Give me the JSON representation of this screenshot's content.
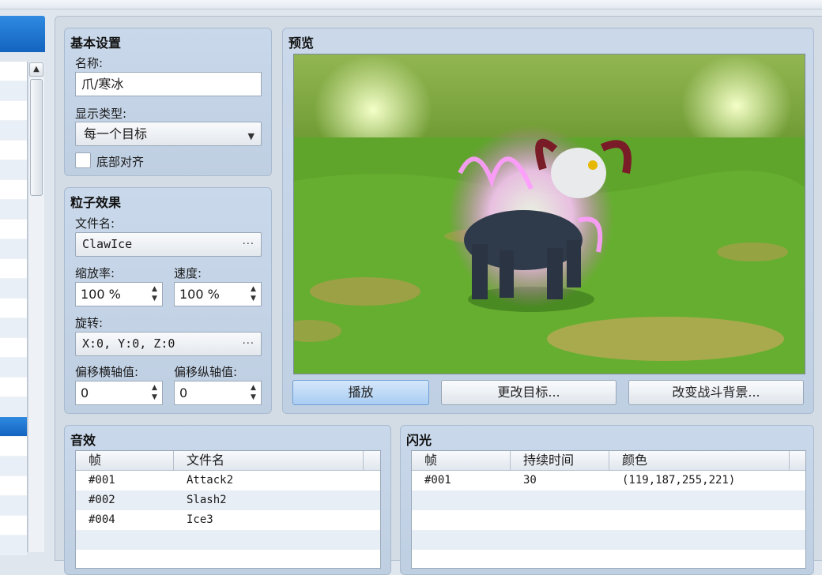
{
  "basic": {
    "title": "基本设置",
    "name_label": "名称:",
    "name_value": "爪/寒冰",
    "display_type_label": "显示类型:",
    "display_type_value": "每一个目标",
    "align_bottom_label": "底部对齐",
    "align_bottom_checked": false
  },
  "particle": {
    "title": "粒子效果",
    "file_label": "文件名:",
    "file_value": "ClawIce",
    "scale_label": "缩放率:",
    "scale_value": "100 %",
    "speed_label": "速度:",
    "speed_value": "100 %",
    "rotation_label": "旋转:",
    "rotation_value": "X:0, Y:0, Z:0",
    "offset_x_label": "偏移横轴值:",
    "offset_x_value": "0",
    "offset_y_label": "偏移纵轴值:",
    "offset_y_value": "0"
  },
  "preview": {
    "title": "预览",
    "play_label": "播放",
    "change_target_label": "更改目标...",
    "change_bg_label": "改变战斗背景..."
  },
  "sound": {
    "title": "音效",
    "columns": [
      "帧",
      "文件名"
    ],
    "rows": [
      {
        "frame": "#001",
        "file": "Attack2"
      },
      {
        "frame": "#002",
        "file": "Slash2"
      },
      {
        "frame": "#004",
        "file": "Ice3"
      }
    ]
  },
  "flash": {
    "title": "闪光",
    "columns": [
      "帧",
      "持续时间",
      "颜色"
    ],
    "rows": [
      {
        "frame": "#001",
        "duration": "30",
        "color": "(119,187,255,221)"
      }
    ]
  },
  "colors": {
    "accent": "#1a6fcf",
    "panel": "#c6d5e8",
    "flash_color": "#77bbff"
  },
  "icons": {
    "dropdown": "triangle-down",
    "ellipsis": "three-dots",
    "spinner": "up-down-arrows",
    "scroll_up": "triangle-up"
  }
}
